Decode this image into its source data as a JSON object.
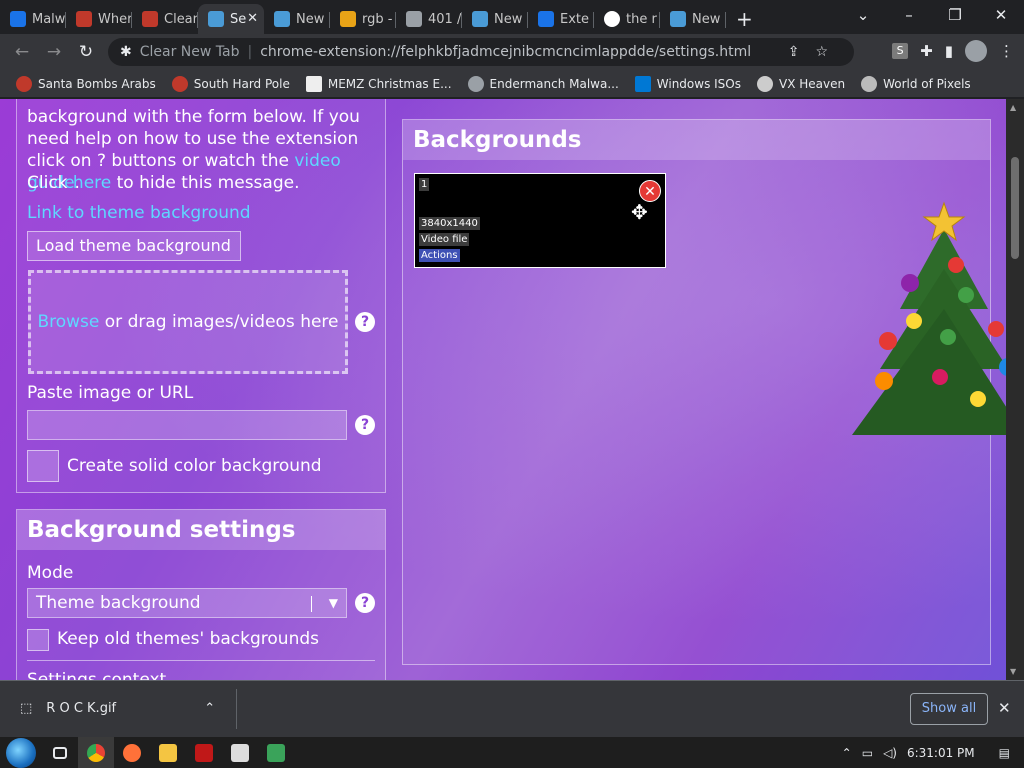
{
  "tabs": [
    {
      "label": "Malw",
      "color": "#1a73e8"
    },
    {
      "label": "Wher",
      "color": "#c0392b"
    },
    {
      "label": "Clear",
      "color": "#c0392b"
    },
    {
      "label": "Se",
      "color": "#4a9bd6",
      "active": true
    },
    {
      "label": "New",
      "color": "#4a9bd6"
    },
    {
      "label": "rgb -",
      "color": "#e8a317"
    },
    {
      "label": "401 /",
      "color": "#9aa0a6"
    },
    {
      "label": "New",
      "color": "#4a9bd6"
    },
    {
      "label": "Exte",
      "color": "#1a73e8"
    },
    {
      "label": "the r",
      "color": "#ffffff"
    },
    {
      "label": "New",
      "color": "#4a9bd6"
    }
  ],
  "window_controls": {
    "minimize": "–",
    "maximize": "❐",
    "close": "✕",
    "tab_search": "⌄",
    "new_tab": "+"
  },
  "toolbar": {
    "back": "←",
    "forward": "→",
    "reload": "↻",
    "site_label": "Clear New Tab",
    "url": "chrome-extension://felphkbfjadmcejnibcmcncimlappdde/settings.html",
    "s_badge": "S",
    "menu": "⋮"
  },
  "bookmarks": [
    {
      "label": "Santa Bombs Arabs",
      "color": "#c0392b"
    },
    {
      "label": "South Hard Pole",
      "color": "#c0392b"
    },
    {
      "label": "MEMZ Christmas E...",
      "color": "#eeeeee"
    },
    {
      "label": "Endermanch Malwa...",
      "color": "#9aa0a6"
    },
    {
      "label": "Windows ISOs",
      "color": "#0078d4"
    },
    {
      "label": "VX Heaven",
      "color": "#cccccc"
    },
    {
      "label": "World of Pixels",
      "color": "#bbbbbb"
    }
  ],
  "left_panel": {
    "intro_line1": "background with the form below. If you",
    "intro_line2": "need help on how to use the extension",
    "intro_line3_a": "click on ? buttons or watch the ",
    "intro_line3_link": "video guide",
    "intro_line3_b": ".",
    "intro_line4_a": "Click ",
    "intro_line4_link": "here",
    "intro_line4_b": " to hide this message.",
    "theme_link": "Link to theme background",
    "load_button": "Load theme background",
    "browse_link": "Browse",
    "drop_text": " or drag images/videos here",
    "paste_label": "Paste image or URL",
    "url_value": "",
    "solid_color_label": "Create solid color background",
    "help": "?"
  },
  "settings_panel": {
    "title": "Background settings",
    "mode_label": "Mode",
    "mode_value": "Theme background",
    "keep_label": "Keep old themes' backgrounds",
    "context_label": "Settings context"
  },
  "backgrounds_panel": {
    "title": "Backgrounds",
    "item": {
      "index": "1",
      "resolution": "3840x1440",
      "type": "Video file",
      "actions": "Actions",
      "delete": "✕"
    }
  },
  "download_bar": {
    "filename": "R O C K.gif",
    "show_all": "Show all",
    "close": "✕"
  },
  "taskbar": {
    "time": "6:31:01 PM"
  }
}
